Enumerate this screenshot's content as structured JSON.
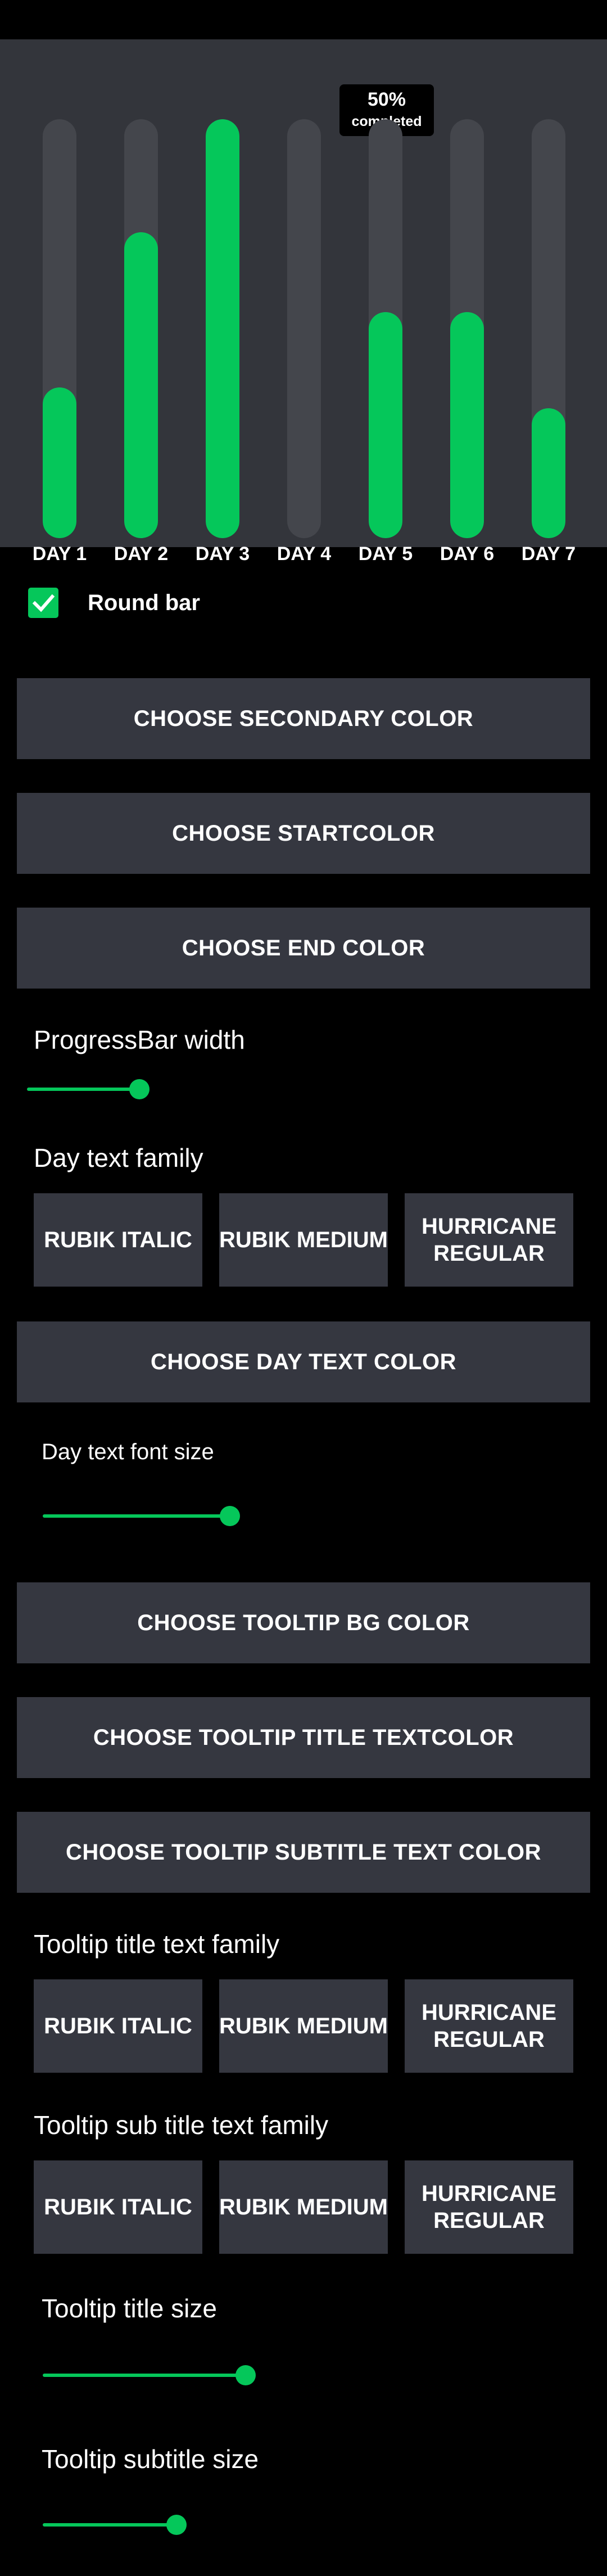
{
  "colors": {
    "bar_fill": "#05c75a",
    "track": "#44464c",
    "panel": "#33353b",
    "button_bg": "#353740"
  },
  "chart": {
    "tooltip": {
      "title": "50%",
      "subtitle": "completed"
    },
    "bars": [
      {
        "label": "DAY 1",
        "progress": 0.36
      },
      {
        "label": "DAY 2",
        "progress": 0.73
      },
      {
        "label": "DAY 3",
        "progress": 1.0
      },
      {
        "label": "DAY 4",
        "progress": 0.0
      },
      {
        "label": "DAY 5",
        "progress": 0.54
      },
      {
        "label": "DAY 6",
        "progress": 0.54
      },
      {
        "label": "DAY 7",
        "progress": 0.31
      }
    ]
  },
  "round_bar": {
    "label": "Round bar",
    "checked": true
  },
  "buttons": {
    "secondary_color": "CHOOSE SECONDARY COLOR",
    "start_color": "CHOOSE STARTCOLOR",
    "end_color": "CHOOSE END COLOR",
    "day_text_color": "CHOOSE DAY TEXT COLOR",
    "tooltip_bg_color": "CHOOSE TOOLTIP BG COLOR",
    "tooltip_title_textcolor": "CHOOSE TOOLTIP TITLE TEXTCOLOR",
    "tooltip_subtitle_text_color": "CHOOSE TOOLTIP SUBTITLE TEXT COLOR"
  },
  "progressbar_width": {
    "label": "ProgressBar width",
    "value": 0.2
  },
  "day_text_family": {
    "label": "Day text family",
    "options": [
      {
        "line1": "RUBIK ITALIC",
        "line2": ""
      },
      {
        "line1": "RUBIK MEDIUM",
        "line2": ""
      },
      {
        "line1": "HURRICANE",
        "line2": "REGULAR"
      }
    ]
  },
  "day_text_font_size": {
    "label": "Day text font size",
    "value": 0.35
  },
  "tooltip_title_family": {
    "label": "Tooltip title text family",
    "options": [
      {
        "line1": "RUBIK ITALIC",
        "line2": ""
      },
      {
        "line1": "RUBIK MEDIUM",
        "line2": ""
      },
      {
        "line1": "HURRICANE",
        "line2": "REGULAR"
      }
    ]
  },
  "tooltip_subtitle_family": {
    "label": "Tooltip sub title text family",
    "options": [
      {
        "line1": "RUBIK ITALIC",
        "line2": ""
      },
      {
        "line1": "RUBIK MEDIUM",
        "line2": ""
      },
      {
        "line1": "HURRICANE",
        "line2": "REGULAR"
      }
    ]
  },
  "tooltip_title_size": {
    "label": "Tooltip title size",
    "value": 0.38
  },
  "tooltip_subtitle_size": {
    "label": "Tooltip subtitle size",
    "value": 0.25
  }
}
